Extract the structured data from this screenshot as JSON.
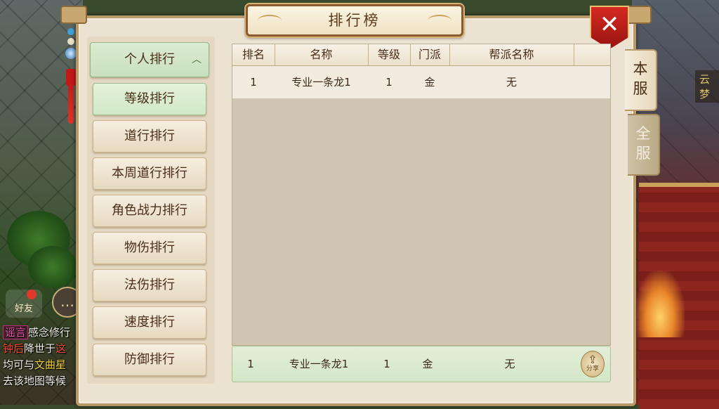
{
  "window": {
    "title": "排行榜",
    "close_icon": "close-icon"
  },
  "categories": {
    "header": "个人排行",
    "items": [
      {
        "label": "等级排行",
        "active": true
      },
      {
        "label": "道行排行",
        "active": false
      },
      {
        "label": "本周道行排行",
        "active": false
      },
      {
        "label": "角色战力排行",
        "active": false
      },
      {
        "label": "物伤排行",
        "active": false
      },
      {
        "label": "法伤排行",
        "active": false
      },
      {
        "label": "速度排行",
        "active": false
      },
      {
        "label": "防御排行",
        "active": false
      }
    ]
  },
  "table": {
    "columns": [
      "排名",
      "名称",
      "等级",
      "门派",
      "帮派名称"
    ],
    "rows": [
      [
        "1",
        "专业一条龙1",
        "1",
        "金",
        "无"
      ]
    ]
  },
  "self_row": [
    "1",
    "专业一条龙1",
    "1",
    "金",
    "无"
  ],
  "share": {
    "label": "分享",
    "icon": "share-icon"
  },
  "server_tabs": {
    "local": [
      "本",
      "服"
    ],
    "all": [
      "全",
      "服"
    ]
  },
  "chat": {
    "lines": [
      {
        "tag": "谣言",
        "text": "感念修行"
      },
      {
        "prefix": "钟后",
        "text": "降世于",
        "suffix": "这"
      },
      {
        "text": "均可与",
        "highlight": "文曲星"
      },
      {
        "text": "去该地图等候"
      }
    ],
    "friend_label": "好友",
    "chat_icon": "chat-bubble-icon"
  },
  "map_label": "云梦",
  "colors": {
    "panel_bg": "#ebe2d2",
    "active_green": "#d2e8c6",
    "close_red": "#c41d19",
    "title_brown": "#5b3a1c"
  }
}
